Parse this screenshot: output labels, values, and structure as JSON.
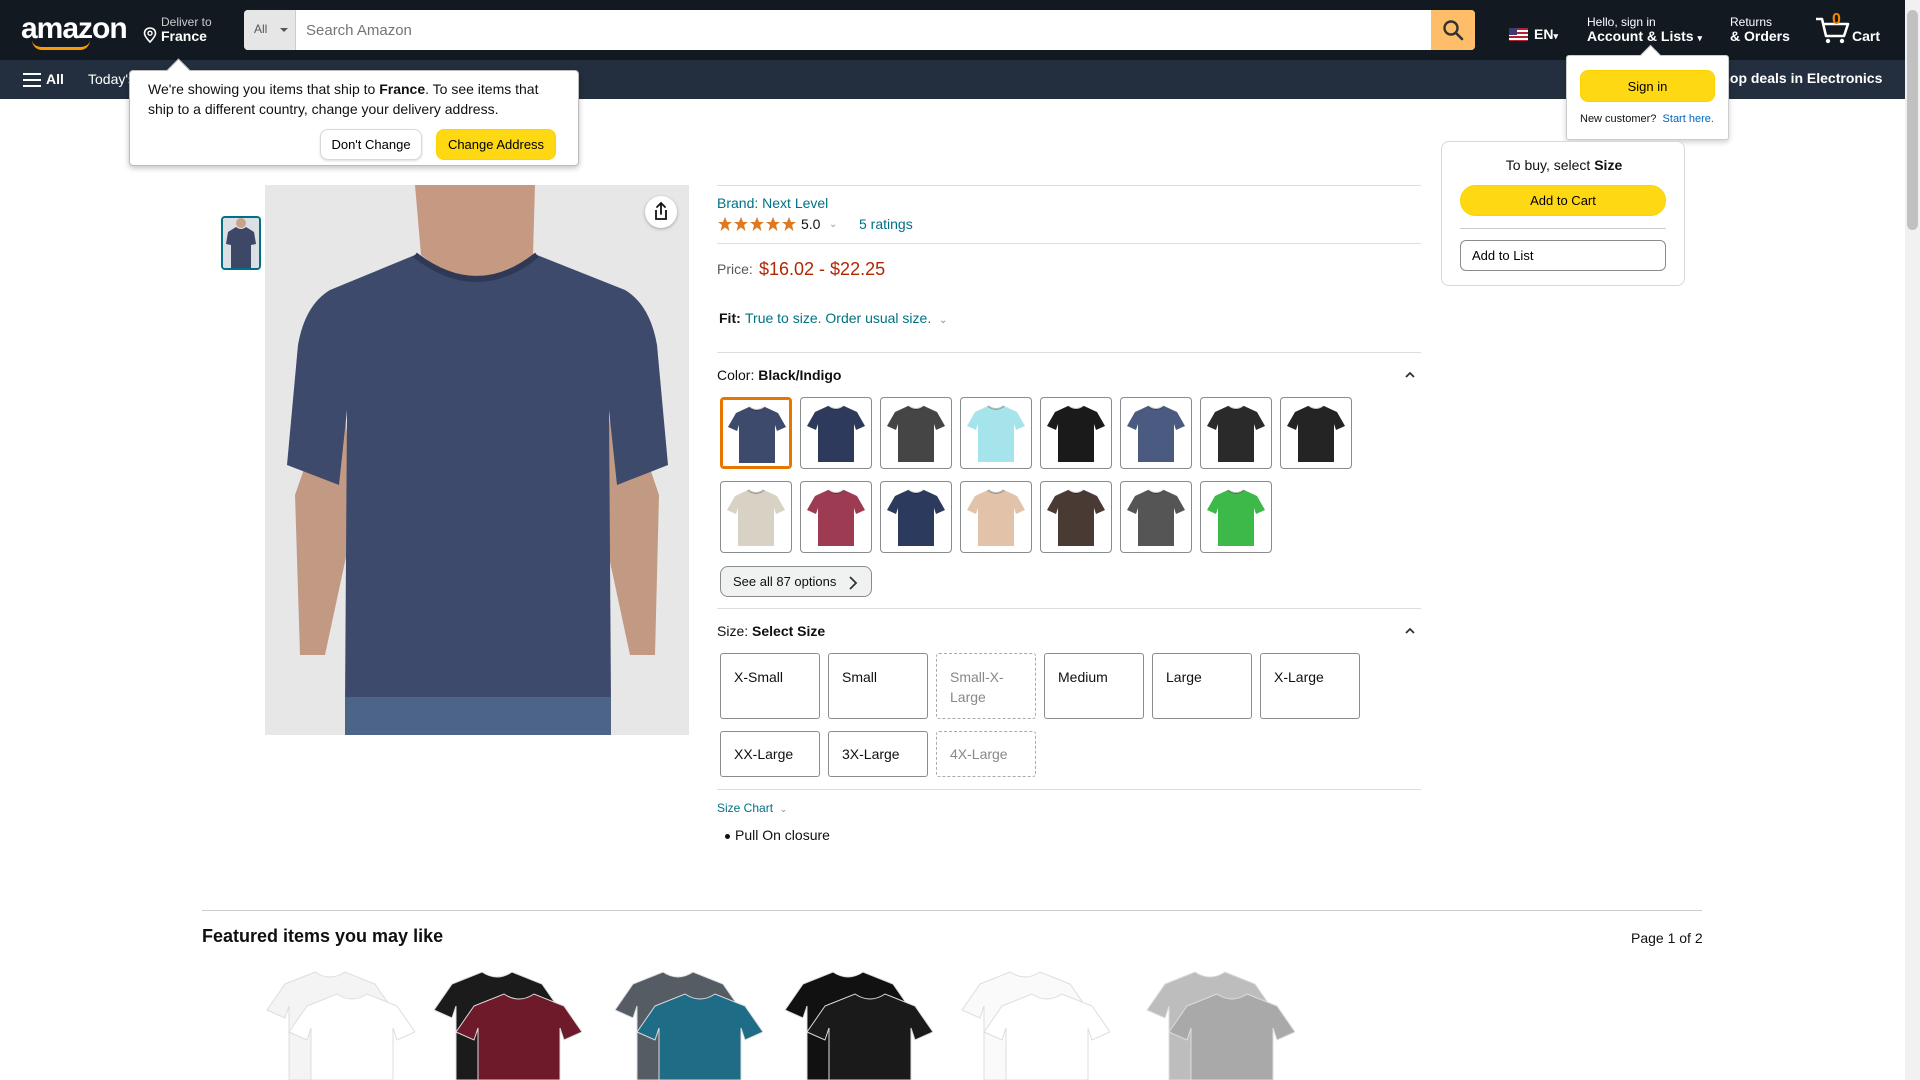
{
  "header": {
    "logo": "amazon",
    "deliver_small": "Deliver to",
    "deliver_country": "France",
    "search_category": "All",
    "search_placeholder": "Search Amazon",
    "language": "EN",
    "account_small": "Hello, sign in",
    "account_big": "Account & Lists",
    "returns_small": "Returns",
    "returns_big": "& Orders",
    "cart_count": "0",
    "cart_label": "Cart"
  },
  "subnav": {
    "all": "All",
    "today": "Today's Deals",
    "promo": "Shop deals in Electronics"
  },
  "address_popover": {
    "text_before": "We're showing you items that ship to ",
    "country": "France",
    "text_after": ". To see items that ship to a different country, change your delivery address.",
    "dont_change": "Don't Change",
    "change_address": "Change Address"
  },
  "signin_popover": {
    "sign_in": "Sign in",
    "new_customer": "New customer?",
    "start_here": "Start here."
  },
  "product": {
    "brand": "Brand: Next Level",
    "rating_value": "5.0",
    "rating_stars": 5,
    "ratings_count": "5 ratings",
    "price_label": "Price:",
    "price_range": "$16.02 - $22.25",
    "fit_label": "Fit:",
    "fit_value": "True to size. Order usual size.",
    "color_label": "Color:",
    "color_selected": "Black/Indigo",
    "see_all": "See all 87 options",
    "size_label": "Size:",
    "size_selected": "Select Size",
    "sizes": [
      {
        "label": "X-Small",
        "available": true
      },
      {
        "label": "Small",
        "available": true
      },
      {
        "label": "Small-X-Large",
        "available": false
      },
      {
        "label": "Medium",
        "available": true
      },
      {
        "label": "Large",
        "available": true
      },
      {
        "label": "X-Large",
        "available": true
      },
      {
        "label": "XX-Large",
        "available": true
      },
      {
        "label": "3X-Large",
        "available": true
      },
      {
        "label": "4X-Large",
        "available": false
      }
    ],
    "size_chart": "Size Chart",
    "bullets": [
      "Pull On closure"
    ]
  },
  "swatch_colors": [
    "#3e4a6b",
    "#2e3a5c",
    "#454545",
    "#a6e4ec",
    "#1a1a1a",
    "#4a5a80",
    "#2a2a2a",
    "#242424",
    "#d8d2c4",
    "#9c3b52",
    "#2c3a5e",
    "#e2c2a8",
    "#4a3a34",
    "#555555",
    "#3db94a"
  ],
  "buybox": {
    "title_prefix": "To buy, select ",
    "title_bold": "Size",
    "add_to_cart": "Add to Cart",
    "add_to_list": "Add to List"
  },
  "featured": {
    "title": "Featured items you may like",
    "page": "Page 1 of 2"
  },
  "colors": {
    "nav_bg": "#131921",
    "subnav_bg": "#232f3e",
    "accent": "#ff9900",
    "link": "#007185",
    "price": "#b12704",
    "button_yellow": "#ffd814"
  }
}
